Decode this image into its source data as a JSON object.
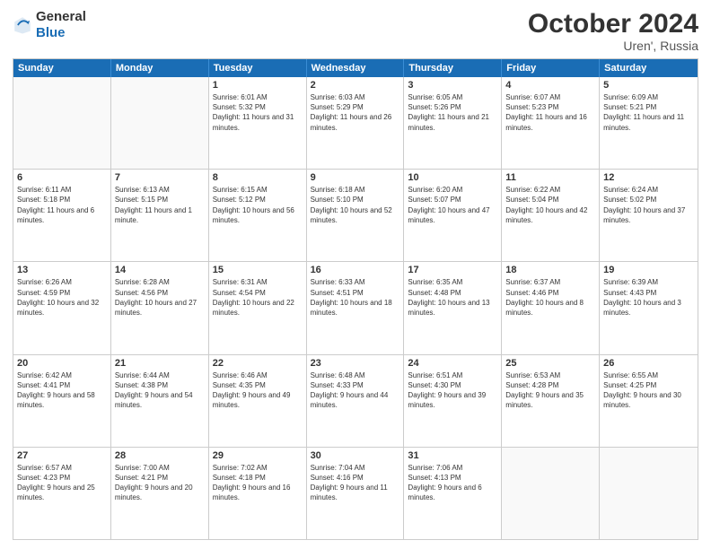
{
  "logo": {
    "general": "General",
    "blue": "Blue"
  },
  "header": {
    "month": "October 2024",
    "location": "Uren', Russia"
  },
  "weekdays": [
    "Sunday",
    "Monday",
    "Tuesday",
    "Wednesday",
    "Thursday",
    "Friday",
    "Saturday"
  ],
  "weeks": [
    [
      {
        "day": "",
        "sunrise": "",
        "sunset": "",
        "daylight": ""
      },
      {
        "day": "",
        "sunrise": "",
        "sunset": "",
        "daylight": ""
      },
      {
        "day": "1",
        "sunrise": "Sunrise: 6:01 AM",
        "sunset": "Sunset: 5:32 PM",
        "daylight": "Daylight: 11 hours and 31 minutes."
      },
      {
        "day": "2",
        "sunrise": "Sunrise: 6:03 AM",
        "sunset": "Sunset: 5:29 PM",
        "daylight": "Daylight: 11 hours and 26 minutes."
      },
      {
        "day": "3",
        "sunrise": "Sunrise: 6:05 AM",
        "sunset": "Sunset: 5:26 PM",
        "daylight": "Daylight: 11 hours and 21 minutes."
      },
      {
        "day": "4",
        "sunrise": "Sunrise: 6:07 AM",
        "sunset": "Sunset: 5:23 PM",
        "daylight": "Daylight: 11 hours and 16 minutes."
      },
      {
        "day": "5",
        "sunrise": "Sunrise: 6:09 AM",
        "sunset": "Sunset: 5:21 PM",
        "daylight": "Daylight: 11 hours and 11 minutes."
      }
    ],
    [
      {
        "day": "6",
        "sunrise": "Sunrise: 6:11 AM",
        "sunset": "Sunset: 5:18 PM",
        "daylight": "Daylight: 11 hours and 6 minutes."
      },
      {
        "day": "7",
        "sunrise": "Sunrise: 6:13 AM",
        "sunset": "Sunset: 5:15 PM",
        "daylight": "Daylight: 11 hours and 1 minute."
      },
      {
        "day": "8",
        "sunrise": "Sunrise: 6:15 AM",
        "sunset": "Sunset: 5:12 PM",
        "daylight": "Daylight: 10 hours and 56 minutes."
      },
      {
        "day": "9",
        "sunrise": "Sunrise: 6:18 AM",
        "sunset": "Sunset: 5:10 PM",
        "daylight": "Daylight: 10 hours and 52 minutes."
      },
      {
        "day": "10",
        "sunrise": "Sunrise: 6:20 AM",
        "sunset": "Sunset: 5:07 PM",
        "daylight": "Daylight: 10 hours and 47 minutes."
      },
      {
        "day": "11",
        "sunrise": "Sunrise: 6:22 AM",
        "sunset": "Sunset: 5:04 PM",
        "daylight": "Daylight: 10 hours and 42 minutes."
      },
      {
        "day": "12",
        "sunrise": "Sunrise: 6:24 AM",
        "sunset": "Sunset: 5:02 PM",
        "daylight": "Daylight: 10 hours and 37 minutes."
      }
    ],
    [
      {
        "day": "13",
        "sunrise": "Sunrise: 6:26 AM",
        "sunset": "Sunset: 4:59 PM",
        "daylight": "Daylight: 10 hours and 32 minutes."
      },
      {
        "day": "14",
        "sunrise": "Sunrise: 6:28 AM",
        "sunset": "Sunset: 4:56 PM",
        "daylight": "Daylight: 10 hours and 27 minutes."
      },
      {
        "day": "15",
        "sunrise": "Sunrise: 6:31 AM",
        "sunset": "Sunset: 4:54 PM",
        "daylight": "Daylight: 10 hours and 22 minutes."
      },
      {
        "day": "16",
        "sunrise": "Sunrise: 6:33 AM",
        "sunset": "Sunset: 4:51 PM",
        "daylight": "Daylight: 10 hours and 18 minutes."
      },
      {
        "day": "17",
        "sunrise": "Sunrise: 6:35 AM",
        "sunset": "Sunset: 4:48 PM",
        "daylight": "Daylight: 10 hours and 13 minutes."
      },
      {
        "day": "18",
        "sunrise": "Sunrise: 6:37 AM",
        "sunset": "Sunset: 4:46 PM",
        "daylight": "Daylight: 10 hours and 8 minutes."
      },
      {
        "day": "19",
        "sunrise": "Sunrise: 6:39 AM",
        "sunset": "Sunset: 4:43 PM",
        "daylight": "Daylight: 10 hours and 3 minutes."
      }
    ],
    [
      {
        "day": "20",
        "sunrise": "Sunrise: 6:42 AM",
        "sunset": "Sunset: 4:41 PM",
        "daylight": "Daylight: 9 hours and 58 minutes."
      },
      {
        "day": "21",
        "sunrise": "Sunrise: 6:44 AM",
        "sunset": "Sunset: 4:38 PM",
        "daylight": "Daylight: 9 hours and 54 minutes."
      },
      {
        "day": "22",
        "sunrise": "Sunrise: 6:46 AM",
        "sunset": "Sunset: 4:35 PM",
        "daylight": "Daylight: 9 hours and 49 minutes."
      },
      {
        "day": "23",
        "sunrise": "Sunrise: 6:48 AM",
        "sunset": "Sunset: 4:33 PM",
        "daylight": "Daylight: 9 hours and 44 minutes."
      },
      {
        "day": "24",
        "sunrise": "Sunrise: 6:51 AM",
        "sunset": "Sunset: 4:30 PM",
        "daylight": "Daylight: 9 hours and 39 minutes."
      },
      {
        "day": "25",
        "sunrise": "Sunrise: 6:53 AM",
        "sunset": "Sunset: 4:28 PM",
        "daylight": "Daylight: 9 hours and 35 minutes."
      },
      {
        "day": "26",
        "sunrise": "Sunrise: 6:55 AM",
        "sunset": "Sunset: 4:25 PM",
        "daylight": "Daylight: 9 hours and 30 minutes."
      }
    ],
    [
      {
        "day": "27",
        "sunrise": "Sunrise: 6:57 AM",
        "sunset": "Sunset: 4:23 PM",
        "daylight": "Daylight: 9 hours and 25 minutes."
      },
      {
        "day": "28",
        "sunrise": "Sunrise: 7:00 AM",
        "sunset": "Sunset: 4:21 PM",
        "daylight": "Daylight: 9 hours and 20 minutes."
      },
      {
        "day": "29",
        "sunrise": "Sunrise: 7:02 AM",
        "sunset": "Sunset: 4:18 PM",
        "daylight": "Daylight: 9 hours and 16 minutes."
      },
      {
        "day": "30",
        "sunrise": "Sunrise: 7:04 AM",
        "sunset": "Sunset: 4:16 PM",
        "daylight": "Daylight: 9 hours and 11 minutes."
      },
      {
        "day": "31",
        "sunrise": "Sunrise: 7:06 AM",
        "sunset": "Sunset: 4:13 PM",
        "daylight": "Daylight: 9 hours and 6 minutes."
      },
      {
        "day": "",
        "sunrise": "",
        "sunset": "",
        "daylight": ""
      },
      {
        "day": "",
        "sunrise": "",
        "sunset": "",
        "daylight": ""
      }
    ]
  ]
}
